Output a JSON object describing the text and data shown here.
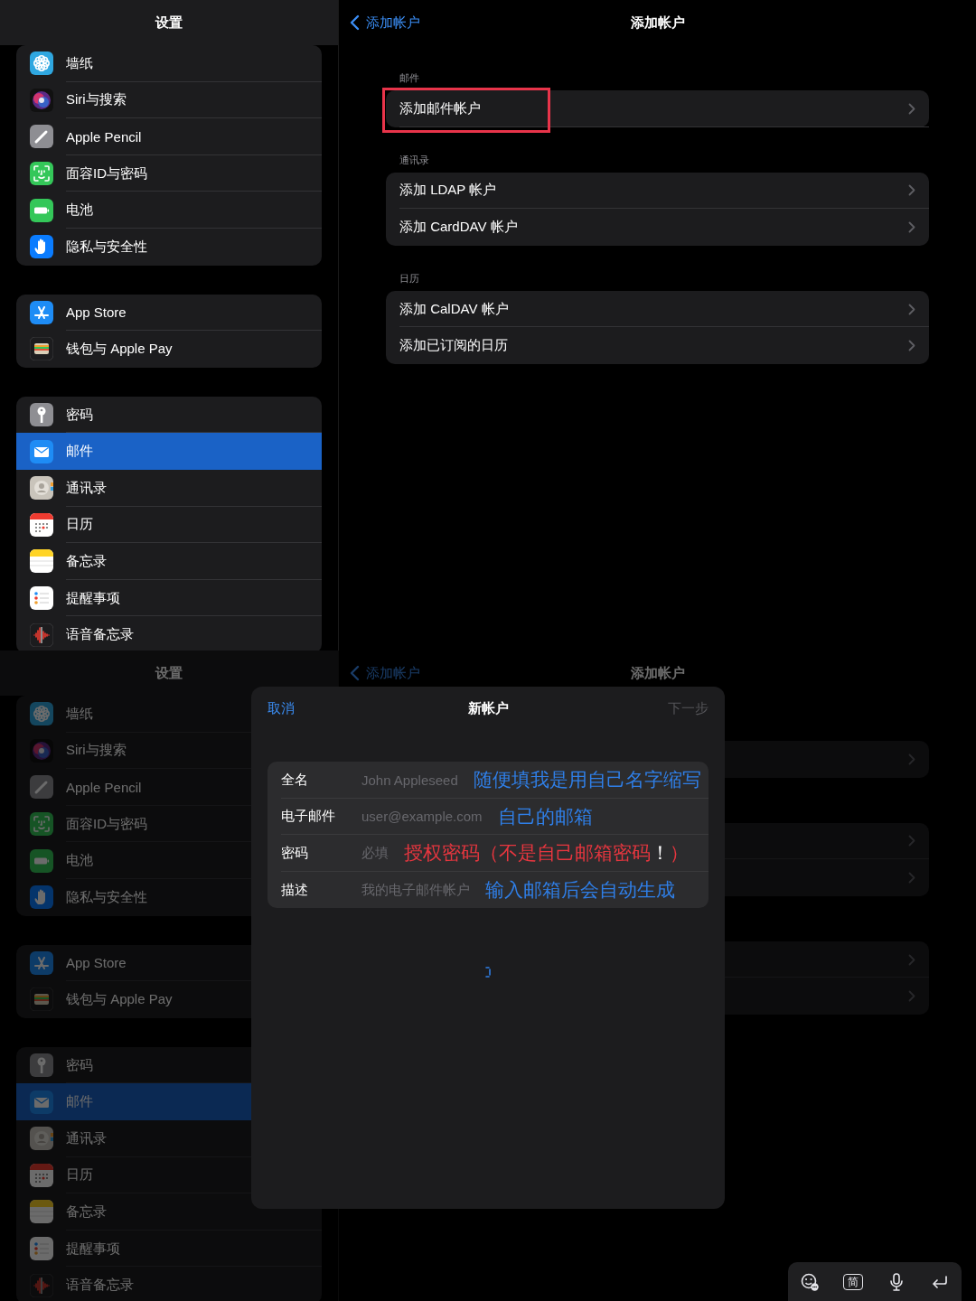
{
  "screens": [
    {
      "kind": "list",
      "dimmed": false,
      "sidebar": {
        "title": "设置",
        "groups": [
          {
            "items": [
              {
                "label": "墙纸",
                "selected": false
              },
              {
                "label": "Siri与搜索",
                "selected": false
              },
              {
                "label": "Apple Pencil",
                "selected": false
              },
              {
                "label": "面容ID与密码",
                "selected": false
              },
              {
                "label": "电池",
                "selected": false
              },
              {
                "label": "隐私与安全性",
                "selected": false
              }
            ]
          },
          {
            "items": [
              {
                "label": "App Store",
                "selected": false
              },
              {
                "label": "钱包与 Apple Pay",
                "selected": false
              }
            ]
          },
          {
            "items": [
              {
                "label": "密码",
                "selected": false
              },
              {
                "label": "邮件",
                "selected": true
              },
              {
                "label": "通讯录",
                "selected": false
              },
              {
                "label": "日历",
                "selected": false
              },
              {
                "label": "备忘录",
                "selected": false
              },
              {
                "label": "提醒事项",
                "selected": false
              },
              {
                "label": "语音备忘录",
                "selected": false
              }
            ]
          }
        ]
      },
      "nav": {
        "back": "添加帐户",
        "title": "添加帐户"
      },
      "sections": [
        {
          "header": "邮件",
          "rows": [
            {
              "kind": "text",
              "label": "添加邮件帐户",
              "highlighted": true
            }
          ]
        },
        {
          "header": "通讯录",
          "rows": [
            {
              "kind": "text",
              "label": "添加 LDAP 帐户",
              "highlighted": false
            },
            {
              "kind": "text",
              "label": "添加 CardDAV 帐户",
              "highlighted": false
            }
          ]
        },
        {
          "header": "日历",
          "rows": [
            {
              "kind": "text",
              "label": "添加 CalDAV 帐户",
              "highlighted": false
            },
            {
              "kind": "text",
              "label": "添加已订阅的日历",
              "highlighted": false
            }
          ]
        }
      ]
    },
    {
      "kind": "sheet",
      "dimmed": true,
      "sidebar": {
        "title": "设置",
        "groups": [
          {
            "items": [
              {
                "label": "墙纸",
                "selected": false
              },
              {
                "label": "Siri与搜索",
                "selected": false
              },
              {
                "label": "Apple Pencil",
                "selected": false
              },
              {
                "label": "面容ID与密码",
                "selected": false
              },
              {
                "label": "电池",
                "selected": false
              },
              {
                "label": "隐私与安全性",
                "selected": false
              }
            ]
          },
          {
            "items": [
              {
                "label": "App Store",
                "selected": false
              },
              {
                "label": "钱包与 Apple Pay",
                "selected": false
              }
            ]
          },
          {
            "items": [
              {
                "label": "密码",
                "selected": false
              },
              {
                "label": "邮件",
                "selected": true
              },
              {
                "label": "通讯录",
                "selected": false
              },
              {
                "label": "日历",
                "selected": false
              },
              {
                "label": "备忘录",
                "selected": false
              },
              {
                "label": "提醒事项",
                "selected": false
              },
              {
                "label": "语音备忘录",
                "selected": false
              }
            ]
          }
        ]
      },
      "nav": {
        "back": "添加帐户",
        "title": "添加帐户"
      },
      "sections": [
        {
          "rows": [
            {
              "kind": "link"
            }
          ]
        },
        {
          "rows": [
            {
              "kind": "link"
            },
            {
              "kind": "link"
            }
          ]
        },
        {
          "rows": [
            {
              "kind": "link"
            },
            {
              "kind": "link"
            }
          ]
        }
      ],
      "sheet": {
        "cancel": "取消",
        "title": "新帐户",
        "next": {
          "label": "下一步",
          "disabled": true
        },
        "loading": true,
        "fields": [
          {
            "label": "全名",
            "placeholder": "John Appleseed",
            "note": [
              {
                "text": "随便填我是用自己名字缩写",
                "color": "#2f7fe8"
              }
            ]
          },
          {
            "label": "电子邮件",
            "placeholder": "user@example.com",
            "note": [
              {
                "text": "自己的邮箱",
                "color": "#2f7fe8"
              }
            ]
          },
          {
            "label": "密码",
            "placeholder": "必填",
            "note": [
              {
                "text": "授权密码（不是自己邮箱密码",
                "color": "#e8363f"
              },
              {
                "text": "！",
                "color": "#ffffff"
              },
              {
                "text": "）",
                "color": "#e8363f"
              }
            ]
          },
          {
            "label": "描述",
            "placeholder": "我的电子邮件帐户",
            "note": [
              {
                "text": "输入邮箱后会自动生成",
                "color": "#2f7fe8"
              }
            ]
          }
        ]
      },
      "keyboard_bar": {
        "keys": [
          {
            "kind": "emoji"
          },
          {
            "kind": "text",
            "label": "简"
          },
          {
            "kind": "mic"
          },
          {
            "kind": "return"
          }
        ]
      }
    }
  ]
}
